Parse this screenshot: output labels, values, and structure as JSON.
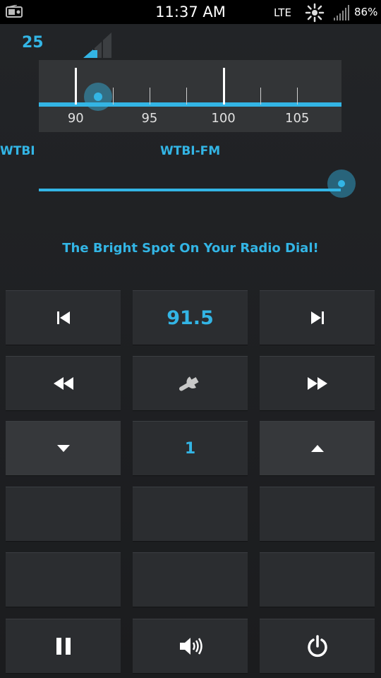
{
  "status_bar": {
    "time": "11:37 AM",
    "network": "LTE",
    "battery": "86%",
    "icons": [
      "radio-icon",
      "gps-icon",
      "signal-icon"
    ]
  },
  "volume": {
    "value": "25"
  },
  "tuner": {
    "tick_labels": [
      "90",
      "95",
      "100",
      "105"
    ],
    "current_frequency": 91.5,
    "range": [
      87.5,
      108
    ]
  },
  "station": {
    "short_name": "WTBI",
    "name": "WTBI-FM",
    "slider_level": 1.0,
    "slogan": "The Bright Spot On Your Radio Dial!"
  },
  "controls": {
    "frequency_label": "91.5",
    "step_label": "1",
    "buttons": [
      "prev-station-icon",
      "next-station-icon",
      "rewind-icon",
      "settings-wrench-icon",
      "fast-forward-icon",
      "down-arrow-icon",
      "up-arrow-icon",
      "pause-icon",
      "speaker-icon",
      "power-icon"
    ]
  },
  "colors": {
    "accent": "#33b5e5",
    "background": "#1d1f21",
    "button": "#2b2d30"
  }
}
